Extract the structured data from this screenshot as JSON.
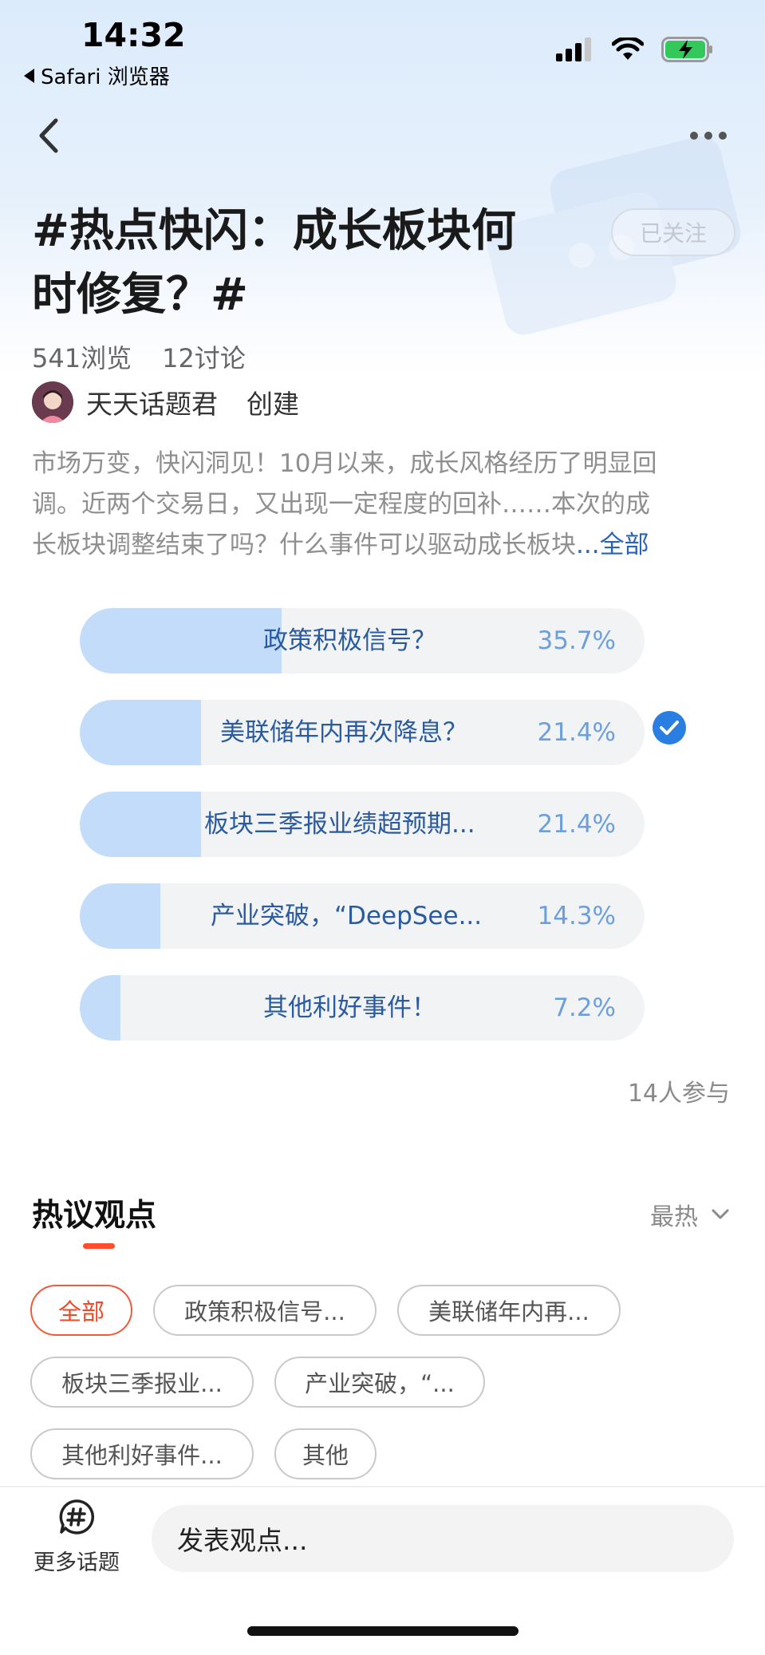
{
  "status_bar": {
    "time": "14:32",
    "back_app": "Safari 浏览器"
  },
  "header": {
    "follow_label": "已关注"
  },
  "topic": {
    "title_line1": "#热点快闪：成长板块何",
    "title_line2": "时修复？#",
    "views": "541浏览",
    "discussions": "12讨论",
    "creator_name": "天天话题君",
    "created_label": "创建",
    "desc_line1": "市场万变，快闪洞见！10月以来，成长风格经历了明显回",
    "desc_line2": "调。近两个交易日，又出现一定程度的回补……本次的成",
    "desc_line3": "长板块调整结束了吗？什么事件可以驱动成长板块",
    "desc_ellipsis": "...",
    "desc_more": "全部"
  },
  "poll": {
    "options": [
      {
        "label": "政策积极信号？",
        "percent": "35.7%",
        "fill": 0.357
      },
      {
        "label": "美联储年内再次降息？",
        "percent": "21.4%",
        "fill": 0.214,
        "selected": true
      },
      {
        "label": "板块三季报业绩超预期...",
        "percent": "21.4%",
        "fill": 0.214
      },
      {
        "label": "产业突破，“DeepSee...",
        "percent": "14.3%",
        "fill": 0.143
      },
      {
        "label": "其他利好事件！",
        "percent": "7.2%",
        "fill": 0.072
      }
    ],
    "participants": "14人参与"
  },
  "discussion": {
    "title": "热议观点",
    "sort_label": "最热",
    "filters": [
      "全部",
      "政策积极信号...",
      "美联储年内再...",
      "板块三季报业...",
      "产业突破，“...",
      "其他利好事件...",
      "其他"
    ]
  },
  "bottom_bar": {
    "more_topics": "更多话题",
    "input_placeholder": "发表观点..."
  },
  "colors": {
    "accent_orange": "#ee4a2a",
    "poll_fill": "#c3dcfa",
    "poll_text": "#2a5ba0",
    "check_blue": "#2a7de1"
  }
}
